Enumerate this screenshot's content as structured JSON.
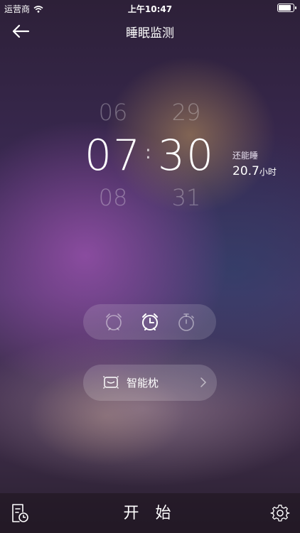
{
  "status_bar": {
    "carrier": "运营商",
    "time": "上午10:47",
    "battery_level": 0.95
  },
  "nav": {
    "title": "睡眠监测",
    "back_icon": "arrow-left-icon"
  },
  "time_picker": {
    "hour_prev": "06",
    "hour": "07",
    "hour_next": "08",
    "minute_prev": "29",
    "minute": "30",
    "minute_next": "31",
    "separator": ":"
  },
  "remaining": {
    "label": "还能睡",
    "value": "20.7",
    "unit": "小时"
  },
  "modes": [
    {
      "icon": "alarm-clock-off-icon",
      "selected": false
    },
    {
      "icon": "alarm-clock-icon",
      "selected": true
    },
    {
      "icon": "stopwatch-icon",
      "selected": false
    }
  ],
  "pillow": {
    "label": "智能枕",
    "icon": "pillow-icon"
  },
  "bottom": {
    "start_label": "开 始",
    "record_icon": "sleep-record-icon",
    "settings_icon": "gear-icon"
  }
}
